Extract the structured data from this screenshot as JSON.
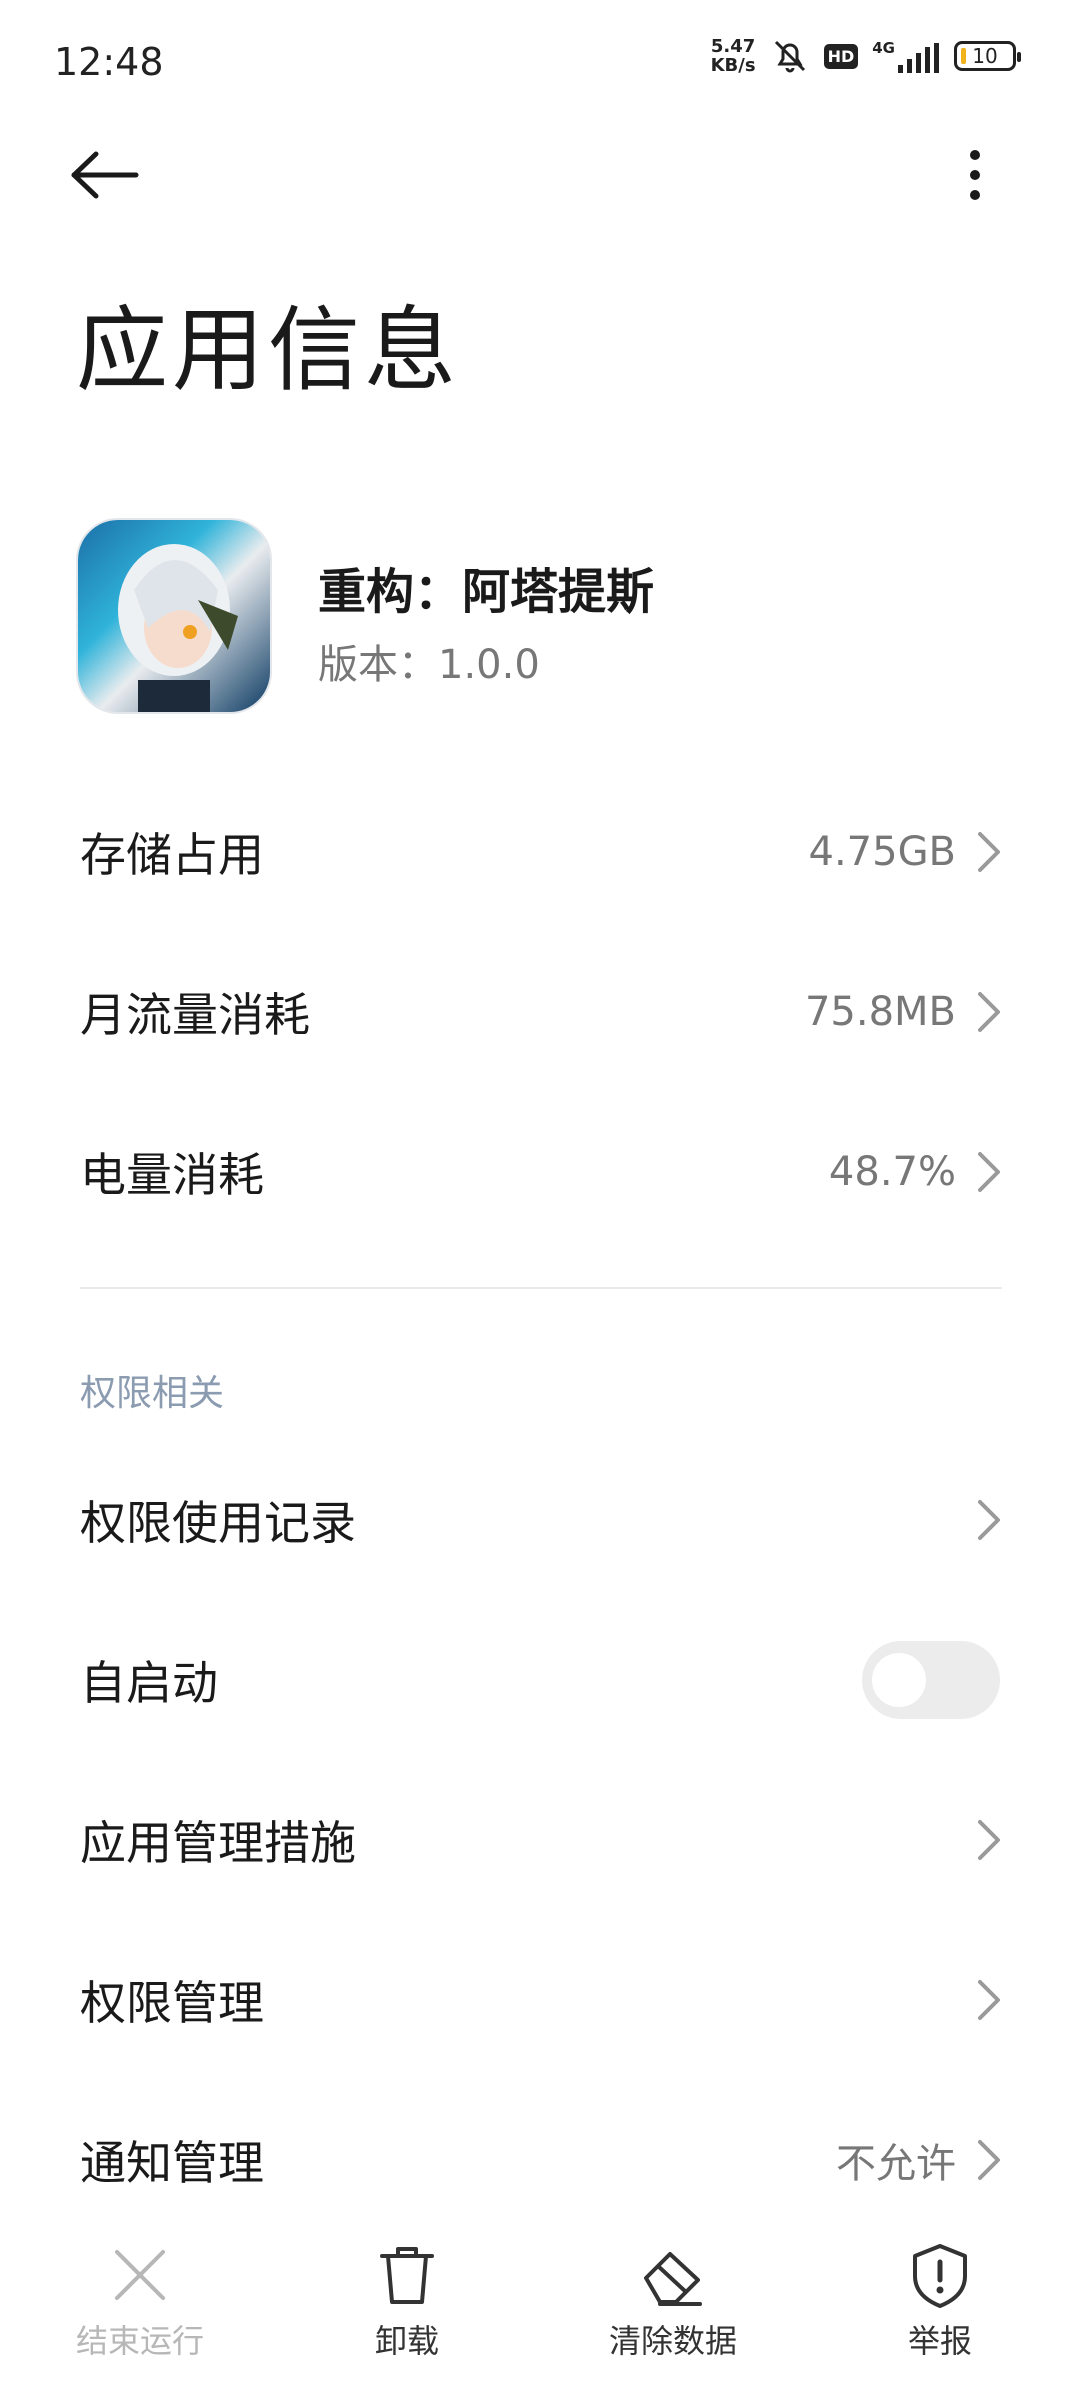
{
  "status_bar": {
    "time": "12:48",
    "net_speed_value": "5.47",
    "net_speed_unit": "KB/s",
    "hd_badge": "HD",
    "signal_type": "4G",
    "battery_level": "10"
  },
  "header": {
    "title": "应用信息"
  },
  "app": {
    "name": "重构：阿塔提斯",
    "version": "版本：1.0.0"
  },
  "usage_rows": [
    {
      "label": "存储占用",
      "value": "4.75GB"
    },
    {
      "label": "月流量消耗",
      "value": "75.8MB"
    },
    {
      "label": "电量消耗",
      "value": "48.7%"
    }
  ],
  "permissions_section": {
    "title": "权限相关",
    "rows": [
      {
        "label": "权限使用记录",
        "value": ""
      },
      {
        "label": "自启动",
        "toggle": false
      },
      {
        "label": "应用管理措施",
        "value": ""
      },
      {
        "label": "权限管理",
        "value": ""
      },
      {
        "label": "通知管理",
        "value": "不允许"
      }
    ]
  },
  "bottom_actions": [
    {
      "label": "结束运行",
      "icon": "close-icon",
      "enabled": false
    },
    {
      "label": "卸载",
      "icon": "trash-icon",
      "enabled": true
    },
    {
      "label": "清除数据",
      "icon": "eraser-icon",
      "enabled": true
    },
    {
      "label": "举报",
      "icon": "shield-alert-icon",
      "enabled": true
    }
  ],
  "colors": {
    "accent_section": "#8b9bb0",
    "battery_low": "#f2b21c",
    "toggle_off": "#ececec"
  }
}
